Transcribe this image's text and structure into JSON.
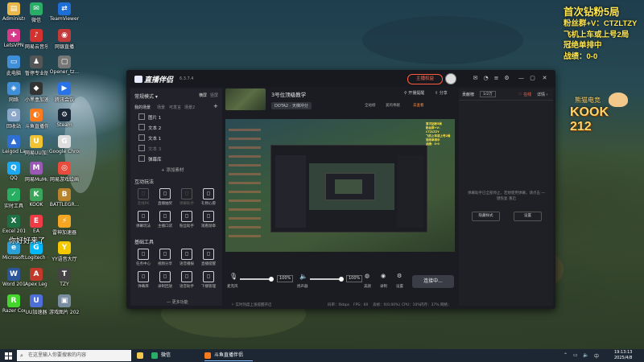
{
  "desktop": {
    "icons": [
      {
        "label": "Administr...",
        "color": "#e9b84a",
        "glyph": "▤"
      },
      {
        "label": "微信",
        "color": "#2aae67",
        "glyph": "✉"
      },
      {
        "label": "TeamViewer",
        "color": "#1d6fd6",
        "glyph": "⇄"
      },
      {
        "label": "LetsVPN",
        "color": "#d63a8a",
        "glyph": "✚"
      },
      {
        "label": "网易云音乐",
        "color": "#d4322f",
        "glyph": "♪"
      },
      {
        "label": "网银直播",
        "color": "#c23a3a",
        "glyph": "◉"
      },
      {
        "label": "此电脑",
        "color": "#3e8ed8",
        "glyph": "▭"
      },
      {
        "label": "暂停专业版",
        "color": "#555555",
        "glyph": "♟"
      },
      {
        "label": "Opener_tz...",
        "color": "#777777",
        "glyph": "▢"
      },
      {
        "label": "网络",
        "color": "#3e8ed8",
        "glyph": "◈"
      },
      {
        "label": "小黑盒加速器",
        "color": "#333333",
        "glyph": "◆"
      },
      {
        "label": "腾讯会议",
        "color": "#2a72e8",
        "glyph": "▶"
      },
      {
        "label": "回收站",
        "color": "#8aa7c9",
        "glyph": "♻"
      },
      {
        "label": "斗鱼直播伴侣",
        "color": "#ff7a1a",
        "glyph": "◐"
      },
      {
        "label": "Steam",
        "color": "#1b2838",
        "glyph": "⚙"
      },
      {
        "label": "Leigod Launcher",
        "color": "#2f6fd3",
        "glyph": "▲"
      },
      {
        "label": "网易UU加速器",
        "color": "#f1c232",
        "glyph": "U"
      },
      {
        "label": "Google Chrome",
        "color": "#dddddd",
        "glyph": "G"
      },
      {
        "label": "QQ",
        "color": "#1ea7f1",
        "glyph": "Q"
      },
      {
        "label": "网易MuMu模拟器",
        "color": "#9b59b6",
        "glyph": "M"
      },
      {
        "label": "网易游戏绘画",
        "color": "#e74c3c",
        "glyph": "◎"
      },
      {
        "label": "实时工具",
        "color": "#27ae60",
        "glyph": "✓"
      },
      {
        "label": "KOOK",
        "color": "#3ba55c",
        "glyph": "K"
      },
      {
        "label": "BATTLEGR...",
        "color": "#b9822c",
        "glyph": "B"
      },
      {
        "label": "Excel 2016",
        "color": "#1e7145",
        "glyph": "X"
      },
      {
        "label": "EA",
        "color": "#ef3b45",
        "glyph": "E"
      },
      {
        "label": "雷神加速器",
        "color": "#f5a623",
        "glyph": "⚡"
      },
      {
        "label": "Microsoft Edge",
        "color": "#2b9fd6",
        "glyph": "e"
      },
      {
        "label": "Logitech G HUB",
        "color": "#00b8fc",
        "glyph": "G"
      },
      {
        "label": "YY语音大厅",
        "color": "#f5c800",
        "glyph": "Y"
      },
      {
        "label": "Word 2016",
        "color": "#2b579a",
        "glyph": "W"
      },
      {
        "label": "Apex Legends",
        "color": "#c0392b",
        "glyph": "A"
      },
      {
        "label": "TZY",
        "color": "#444444",
        "glyph": "T"
      },
      {
        "label": "Razer Cortex",
        "color": "#44d62c",
        "glyph": "R"
      },
      {
        "label": "UU加速器",
        "color": "#4f6fd8",
        "glyph": "U"
      },
      {
        "label": "游戏图片 20230311",
        "color": "#7a8ca0",
        "glyph": "▣"
      }
    ],
    "floating_text": "你好好来了"
  },
  "overlay": {
    "title": "首次钻粉5局",
    "lines": [
      "粉丝群+V：CTZLTZY",
      "飞机上车或上号2局",
      "冠绝单排中",
      "战绩：0-0"
    ],
    "logo_text": "KOOK 212",
    "logo_sub": "熊猫电竞"
  },
  "app": {
    "name": "直播伴侣",
    "version": "6.3.7.4",
    "live_button": "主播权益",
    "left": {
      "mode": "常规模式",
      "mode_links": [
        "横屏",
        "竖屏"
      ],
      "scene_tabs": [
        "我的场景",
        "场景",
        "可发言",
        "场景2"
      ],
      "sources": [
        "图片 1",
        "文本 2",
        "文本 1",
        "文本 3",
        "弹幕库"
      ],
      "add_source": "+ 添加素材",
      "interact_title": "互动玩法",
      "interact_tools": [
        "连线PK",
        "直播抽奖",
        "弹幕助手",
        "礼物心愿",
        "弹幕玩法",
        "主播口袋",
        "粉丝助手",
        "观看勋章"
      ],
      "basic_title": "基础工具",
      "basic_tools": [
        "任务中心",
        "视频分享",
        "语音播报",
        "直播提醒",
        "弹幕库",
        "录制回放",
        "语音助手",
        "下播管理"
      ],
      "more": "— 更多功能"
    },
    "center": {
      "room_title": "3号位顶级教学",
      "room_category": "DOTA2 · 天梯冲分",
      "top_links": [
        "开播提醒",
        "分享"
      ],
      "stats_labels": [
        "全站榜",
        "爱的奉献",
        "去查看"
      ],
      "mic_label": "麦克风",
      "mic_pct": "100%",
      "speaker_label": "扬声器",
      "speaker_pct": "100%",
      "beauty_label": "美颜",
      "record_label": "录制",
      "settings_label": "设置",
      "start_button": "连接中...",
      "bottom_hint": "实时热度上涨提醒开启",
      "status": [
        "码率：0kbps",
        "FPS：60",
        "丢帧：0(0.00%)",
        "CPU：10%",
        "内存：37%",
        "网络："
      ]
    },
    "right": {
      "tab_labels": [
        "贡献榜",
        "1/2万"
      ],
      "online_label": "在线",
      "more_label": "详情",
      "message": "弹幕助手已全部停止，若想使用弹幕，请点击 一键恢复 重启",
      "button1": "隐藏样式",
      "button2": "设置"
    }
  },
  "taskbar": {
    "search_placeholder": "在这里输入你要搜索的内容",
    "apps": [
      "微信",
      "斗鱼直播伴侣"
    ],
    "time": "19:13:13",
    "date": "2025/4/8"
  }
}
